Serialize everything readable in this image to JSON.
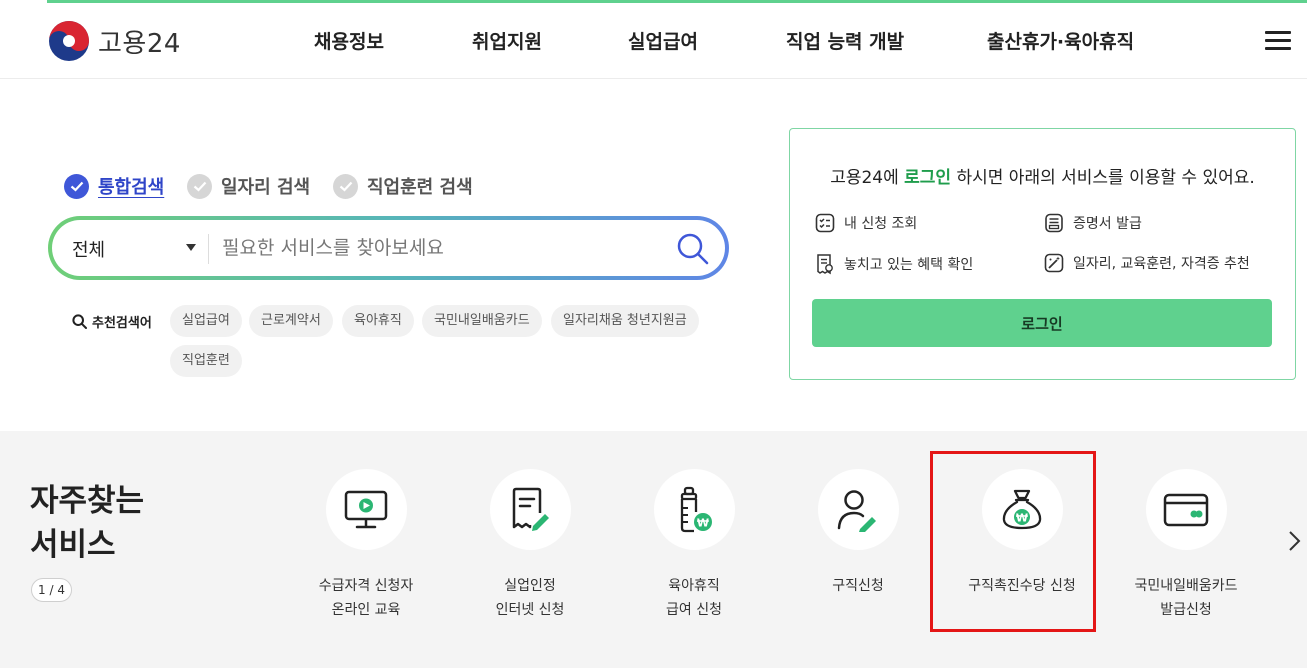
{
  "header": {
    "logo_text": "고용24",
    "nav": [
      "채용정보",
      "취업지원",
      "실업급여",
      "직업 능력 개발",
      "출산휴가·육아휴직"
    ]
  },
  "search": {
    "tabs": [
      "통합검색",
      "일자리 검색",
      "직업훈련 검색"
    ],
    "active_tab": "통합검색",
    "scope": "전체",
    "placeholder": "필요한 서비스를 찾아보세요",
    "recommend_label": "추천검색어",
    "keywords": [
      "실업급여",
      "근로계약서",
      "육아휴직",
      "국민내일배움카드",
      "일자리채움 청년지원금",
      "직업훈련"
    ]
  },
  "login": {
    "title_prefix": "고용24에 ",
    "title_highlight": "로그인",
    "title_suffix": " 하시면 아래의 서비스를 이용할 수 있어요.",
    "features": [
      "내 신청 조회",
      "증명서 발급",
      "놓치고 있는 혜택 확인",
      "일자리, 교육훈련, 자격증 추천"
    ],
    "button": "로그인"
  },
  "services": {
    "title_line1": "자주찾는",
    "title_line2": "서비스",
    "pager": "1 / 4",
    "items": [
      {
        "line1": "수급자격 신청자",
        "line2": "온라인 교육",
        "icon": "monitor-play-icon"
      },
      {
        "line1": "실업인정",
        "line2": "인터넷 신청",
        "icon": "document-pen-icon"
      },
      {
        "line1": "육아휴직",
        "line2": "급여 신청",
        "icon": "baby-bottle-won-icon"
      },
      {
        "line1": "구직신청",
        "line2": "",
        "icon": "person-pen-icon"
      },
      {
        "line1": "구직촉진수당 신청",
        "line2": "",
        "icon": "money-bag-icon"
      },
      {
        "line1": "국민내일배움카드",
        "line2": "발급신청",
        "icon": "card-icon"
      }
    ]
  },
  "colors": {
    "brand_green": "#5fd18e",
    "active_blue": "#3f57d8",
    "highlight_red": "#e41616"
  }
}
